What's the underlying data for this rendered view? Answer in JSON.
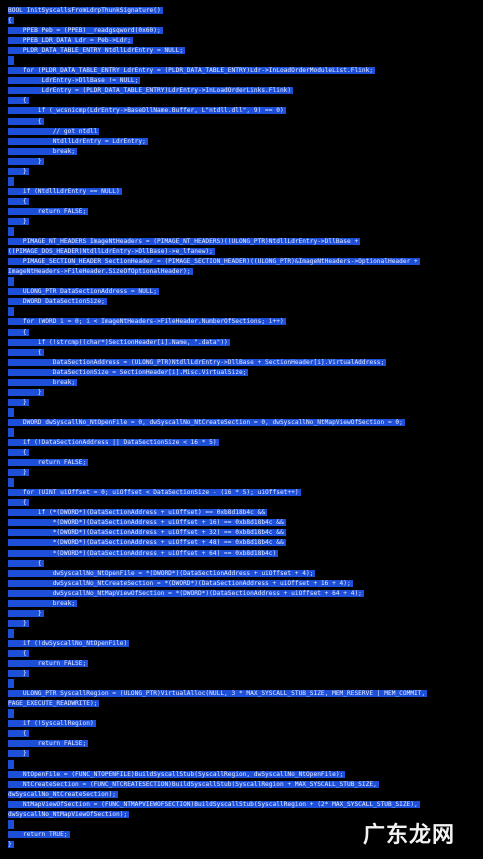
{
  "editor": {
    "selection_color": "#1d4fd8",
    "background_color": "#000000",
    "lines": [
      "BOOL InitSyscallsFromLdrpThunkSignature()",
      "{",
      "    PPEB Peb = (PPEB)__readgsqword(0x60);",
      "    PPEB_LDR_DATA Ldr = Peb->Ldr;",
      "    PLDR_DATA_TABLE_ENTRY NtdllLdrEntry = NULL;",
      "",
      "    for (PLDR_DATA_TABLE_ENTRY LdrEntry = (PLDR_DATA_TABLE_ENTRY)Ldr->InLoadOrderModuleList.Flink;",
      "         LdrEntry->DllBase != NULL;",
      "         LdrEntry = (PLDR_DATA_TABLE_ENTRY)LdrEntry->InLoadOrderLinks.Flink)",
      "    {",
      "        if (_wcsnicmp(LdrEntry->BaseDllName.Buffer, L\"ntdll.dll\", 9) == 0)",
      "        {",
      "            // got ntdll",
      "            NtdllLdrEntry = LdrEntry;",
      "            break;",
      "        }",
      "    }",
      "",
      "    if (NtdllLdrEntry == NULL)",
      "    {",
      "        return FALSE;",
      "    }",
      "",
      "    PIMAGE_NT_HEADERS ImageNtHeaders = (PIMAGE_NT_HEADERS)((ULONG_PTR)NtdllLdrEntry->DllBase +",
      "((PIMAGE_DOS_HEADER)NtdllLdrEntry->DllBase)->e_lfanew);",
      "    PIMAGE_SECTION_HEADER SectionHeader = (PIMAGE_SECTION_HEADER)((ULONG_PTR)&ImageNtHeaders->OptionalHeader +",
      "ImageNtHeaders->FileHeader.SizeOfOptionalHeader);",
      "",
      "    ULONG_PTR DataSectionAddress = NULL;",
      "    DWORD DataSectionSize;",
      "",
      "    for (WORD i = 0; i < ImageNtHeaders->FileHeader.NumberOfSections; i++)",
      "    {",
      "        if (!strcmp((char*)SectionHeader[i].Name, \".data\"))",
      "        {",
      "            DataSectionAddress = (ULONG_PTR)NtdllLdrEntry->DllBase + SectionHeader[i].VirtualAddress;",
      "            DataSectionSize = SectionHeader[i].Misc.VirtualSize;",
      "            break;",
      "        }",
      "    }",
      "",
      "    DWORD dwSyscallNo_NtOpenFile = 0, dwSyscallNo_NtCreateSection = 0, dwSyscallNo_NtMapViewOfSection = 0;",
      "",
      "    if (!DataSectionAddress || DataSectionSize < 16 * 5)",
      "    {",
      "        return FALSE;",
      "    }",
      "",
      "    for (UINT uiOffset = 0; uiOffset < DataSectionSize - (16 * 5); uiOffset++)",
      "    {",
      "        if (*(DWORD*)(DataSectionAddress + uiOffset) == 0xb8d18b4c &&",
      "            *(DWORD*)(DataSectionAddress + uiOffset + 16) == 0xb8d18b4c &&",
      "            *(DWORD*)(DataSectionAddress + uiOffset + 32) == 0xb8d18b4c &&",
      "            *(DWORD*)(DataSectionAddress + uiOffset + 48) == 0xb8d18b4c &&",
      "            *(DWORD*)(DataSectionAddress + uiOffset + 64) == 0xb8d18b4c)",
      "        {",
      "            dwSyscallNo_NtOpenFile = *(DWORD*)(DataSectionAddress + uiOffset + 4);",
      "            dwSyscallNo_NtCreateSection = *(DWORD*)(DataSectionAddress + uiOffset + 16 + 4);",
      "            dwSyscallNo_NtMapViewOfSection = *(DWORD*)(DataSectionAddress + uiOffset + 64 + 4);",
      "            break;",
      "        }",
      "    }",
      "",
      "    if (!dwSyscallNo_NtOpenFile)",
      "    {",
      "        return FALSE;",
      "    }",
      "",
      "    ULONG_PTR SyscallRegion = (ULONG_PTR)VirtualAlloc(NULL, 3 * MAX_SYSCALL_STUB_SIZE, MEM_RESERVE | MEM_COMMIT,",
      "PAGE_EXECUTE_READWRITE);",
      "",
      "    if (!SyscallRegion)",
      "    {",
      "        return FALSE;",
      "    }",
      "",
      "    NtOpenFile = (FUNC_NTOPENFILE)BuildSyscallStub(SyscallRegion, dwSyscallNo_NtOpenFile);",
      "    NtCreateSection = (FUNC_NTCREATESECTION)BuildSyscallStub(SyscallRegion + MAX_SYSCALL_STUB_SIZE,",
      "dwSyscallNo_NtCreateSection);",
      "    NtMapViewOfSection = (FUNC_NTMAPVIEWOFSECTION)BuildSyscallStub(SyscallRegion + (2* MAX_SYSCALL_STUB_SIZE),",
      "dwSyscallNo_NtMapViewOfSection);",
      "",
      "    return TRUE;",
      "}"
    ]
  },
  "watermark": {
    "text": "广东龙网"
  }
}
